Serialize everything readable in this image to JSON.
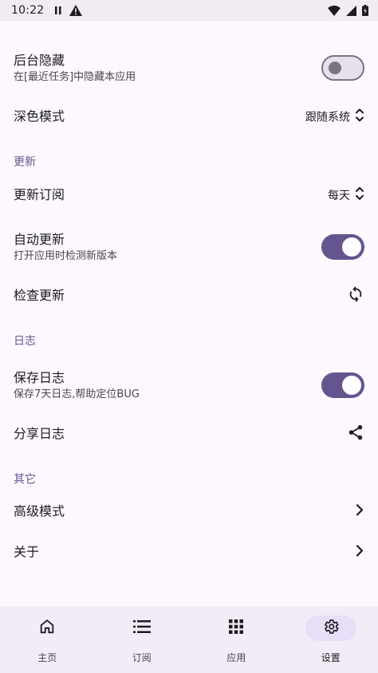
{
  "status_bar": {
    "time": "10:22",
    "icons": [
      "pause-icon",
      "warning-icon",
      "wifi-icon",
      "signal-icon",
      "battery-icon"
    ]
  },
  "settings": {
    "hide_background": {
      "title": "后台隐藏",
      "subtitle": "在[最近任务]中隐藏本应用",
      "enabled": false
    },
    "dark_mode": {
      "title": "深色模式",
      "value": "跟随系统"
    }
  },
  "sections": {
    "update": {
      "header": "更新",
      "subscription": {
        "title": "更新订阅",
        "value": "每天"
      },
      "auto_update": {
        "title": "自动更新",
        "subtitle": "打开应用时检测新版本",
        "enabled": true
      },
      "check_update": {
        "title": "检查更新"
      }
    },
    "log": {
      "header": "日志",
      "save_log": {
        "title": "保存日志",
        "subtitle": "保存7天日志,帮助定位BUG",
        "enabled": true
      },
      "share_log": {
        "title": "分享日志"
      }
    },
    "other": {
      "header": "其它",
      "advanced": {
        "title": "高级模式"
      },
      "about": {
        "title": "关于"
      }
    }
  },
  "bottom_nav": {
    "items": [
      {
        "label": "主页",
        "icon": "home-icon",
        "active": false
      },
      {
        "label": "订阅",
        "icon": "list-icon",
        "active": false
      },
      {
        "label": "应用",
        "icon": "apps-grid-icon",
        "active": false
      },
      {
        "label": "设置",
        "icon": "gear-icon",
        "active": true
      }
    ]
  },
  "colors": {
    "accent": "#65558f",
    "background": "#fdf8ff",
    "nav_background": "#f2ecf6",
    "active_pill": "#e8def8"
  }
}
